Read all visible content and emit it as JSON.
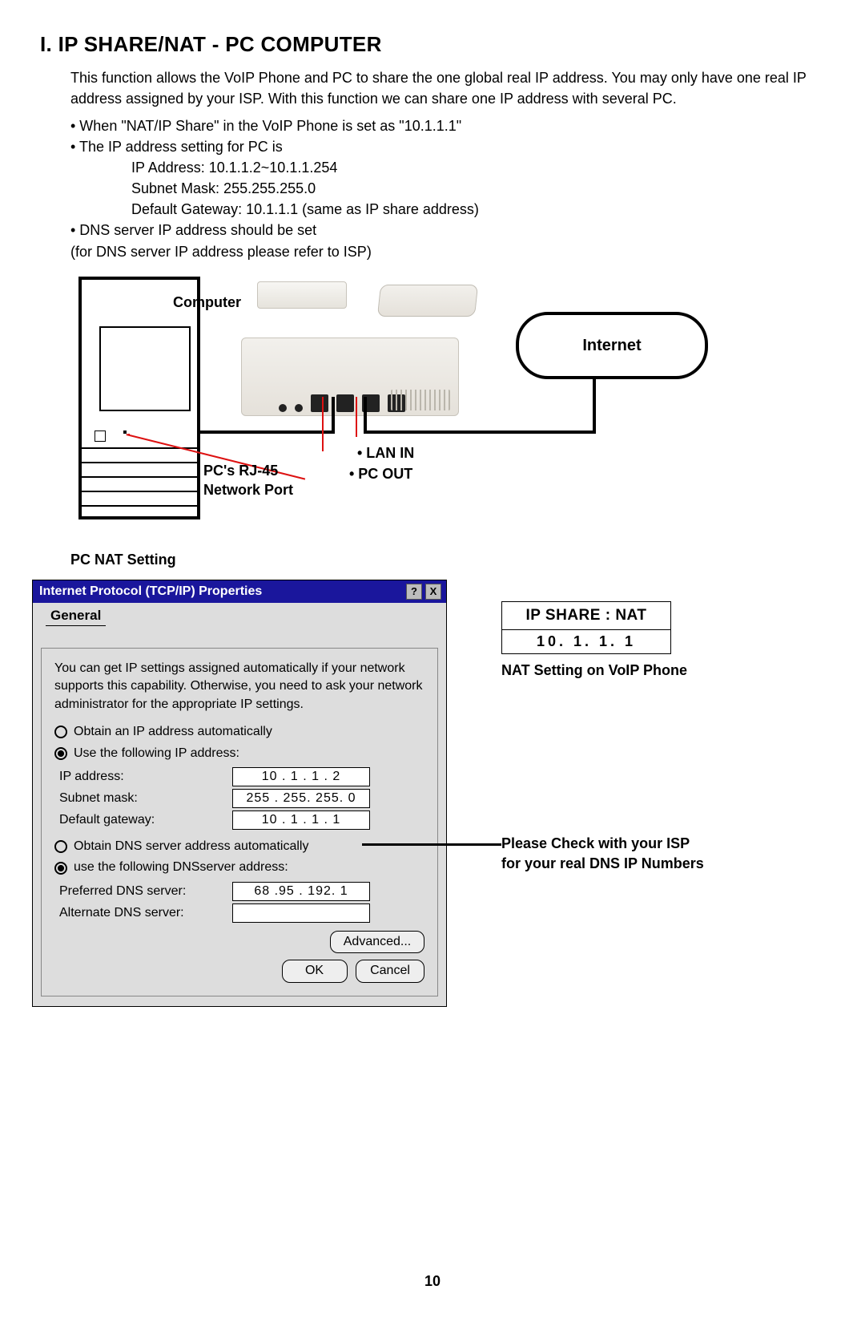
{
  "heading": "I. IP SHARE/NAT - PC COMPUTER",
  "intro": "This function allows the VoIP Phone and PC to share the one global real IP address. You may only have one real IP address assigned by your ISP. With this function we can share one IP address with several PC.",
  "bullets": {
    "b1": "• When \"NAT/IP Share\" in the VoIP Phone is set as \"10.1.1.1\"",
    "b2": "• The IP address setting for PC is",
    "i1": "IP Address: 10.1.1.2~10.1.1.254",
    "i2": "Subnet Mask: 255.255.255.0",
    "i3": "Default Gateway: 10.1.1.1 (same as IP share address)",
    "b3": "• DNS server IP address should be set",
    "b4": "(for DNS server IP address please refer to ISP)"
  },
  "diagram": {
    "computer": "Computer",
    "internet": "Internet",
    "pc_port_1": "PC's RJ-45",
    "pc_port_2": "Network Port",
    "lan_in": "• LAN IN",
    "pc_out": "• PC OUT"
  },
  "pcnat_heading": "PC NAT Setting",
  "dialog": {
    "title": "Internet Protocol (TCP/IP) Properties",
    "help_icon": "?",
    "close_icon": "X",
    "tab": "General",
    "desc": "You can get IP settings assigned automatically if your network supports this capability. Otherwise, you need to ask your network administrator for the appropriate IP settings.",
    "opt_auto_ip": "Obtain an IP address automatically",
    "opt_manual_ip": "Use the following IP address:",
    "ip_label": "IP address:",
    "ip_value": "10   .  1   .  1   .  2",
    "mask_label": "Subnet mask:",
    "mask_value": "255 . 255. 255.  0",
    "gw_label": "Default gateway:",
    "gw_value": "10   .  1   .  1   .  1",
    "opt_auto_dns": "Obtain DNS server address automatically",
    "opt_manual_dns": "use the following DNSserver address:",
    "dns1_label": "Preferred DNS server:",
    "dns1_value": "68   .95   . 192.  1",
    "dns2_label": "Alternate DNS server:",
    "dns2_value": "",
    "advanced": "Advanced...",
    "ok": "OK",
    "cancel": "Cancel"
  },
  "natbox": {
    "title": "IP SHARE : NAT",
    "value": "10. 1. 1. 1",
    "caption": "NAT Setting on VoIP Phone"
  },
  "dns_note_1": "Please Check with your ISP",
  "dns_note_2": "for your real DNS IP Numbers",
  "page_number": "10"
}
